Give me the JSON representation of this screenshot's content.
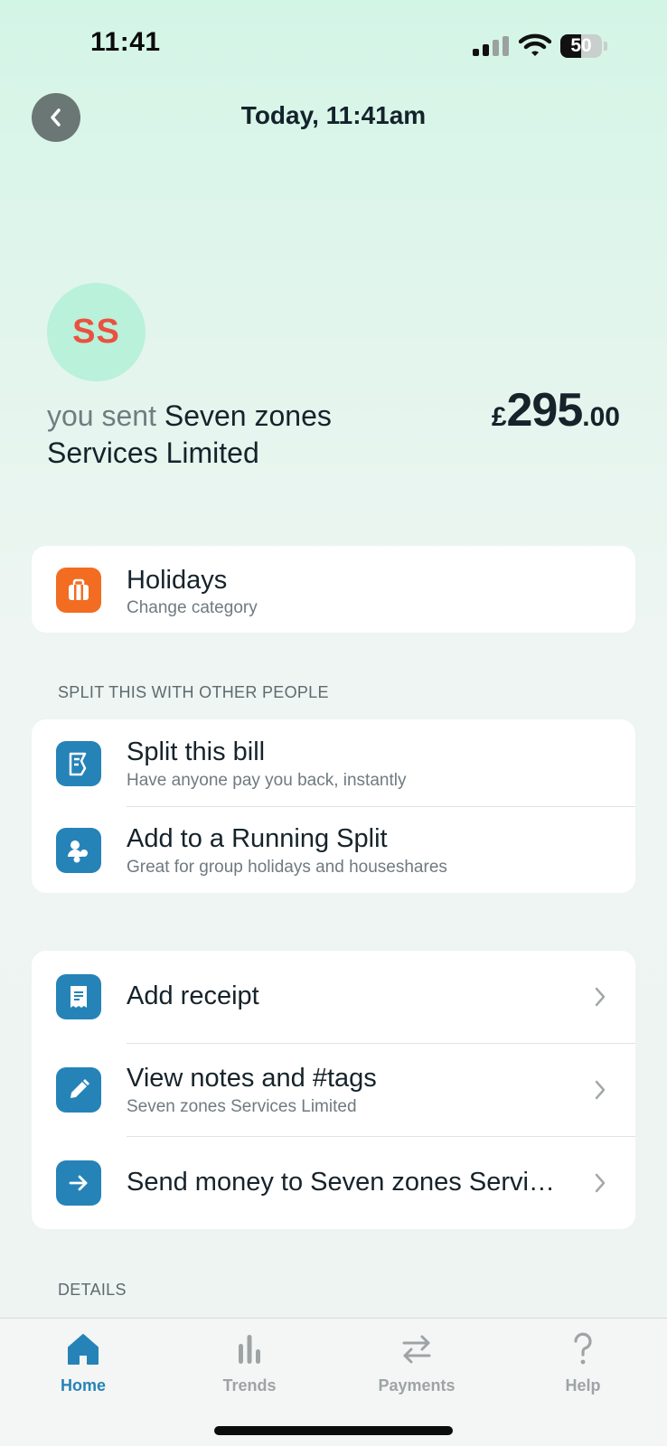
{
  "status_bar": {
    "time": "11:41",
    "battery": "50",
    "battery_level": 0.5
  },
  "header": {
    "title": "Today, 11:41am"
  },
  "merchant": {
    "initials": "SS",
    "prefix": "you sent",
    "name": "Seven zones Services Limited",
    "amount_currency": "£",
    "amount_major": "295",
    "amount_minor": ".00"
  },
  "category": {
    "title": "Holidays",
    "subtitle": "Change category"
  },
  "split_section": {
    "label": "SPLIT THIS WITH OTHER PEOPLE",
    "items": [
      {
        "title": "Split this bill",
        "subtitle": "Have anyone pay you back, instantly",
        "icon": "split-bill-icon"
      },
      {
        "title": "Add to a Running Split",
        "subtitle": "Great for group holidays and houseshares",
        "icon": "running-split-icon"
      }
    ]
  },
  "actions": {
    "items": [
      {
        "title": "Add receipt",
        "icon": "receipt-icon"
      },
      {
        "title": "View notes and #tags",
        "subtitle": "Seven zones Services Limited",
        "icon": "pencil-icon"
      },
      {
        "title": "Send money to Seven zones Servi…",
        "icon": "arrow-right-icon"
      }
    ]
  },
  "details": {
    "label": "DETAILS"
  },
  "tab_bar": {
    "tabs": [
      {
        "label": "Home",
        "icon": "home-icon",
        "active": true
      },
      {
        "label": "Trends",
        "icon": "trends-icon",
        "active": false
      },
      {
        "label": "Payments",
        "icon": "payments-icon",
        "active": false
      },
      {
        "label": "Help",
        "icon": "help-icon",
        "active": false
      }
    ]
  },
  "colors": {
    "accent": "#2683b8",
    "category_orange": "#f26d21",
    "icon_blue": "#2683b8",
    "avatar_bg": "#b9f1da",
    "avatar_text": "#ea5140"
  }
}
